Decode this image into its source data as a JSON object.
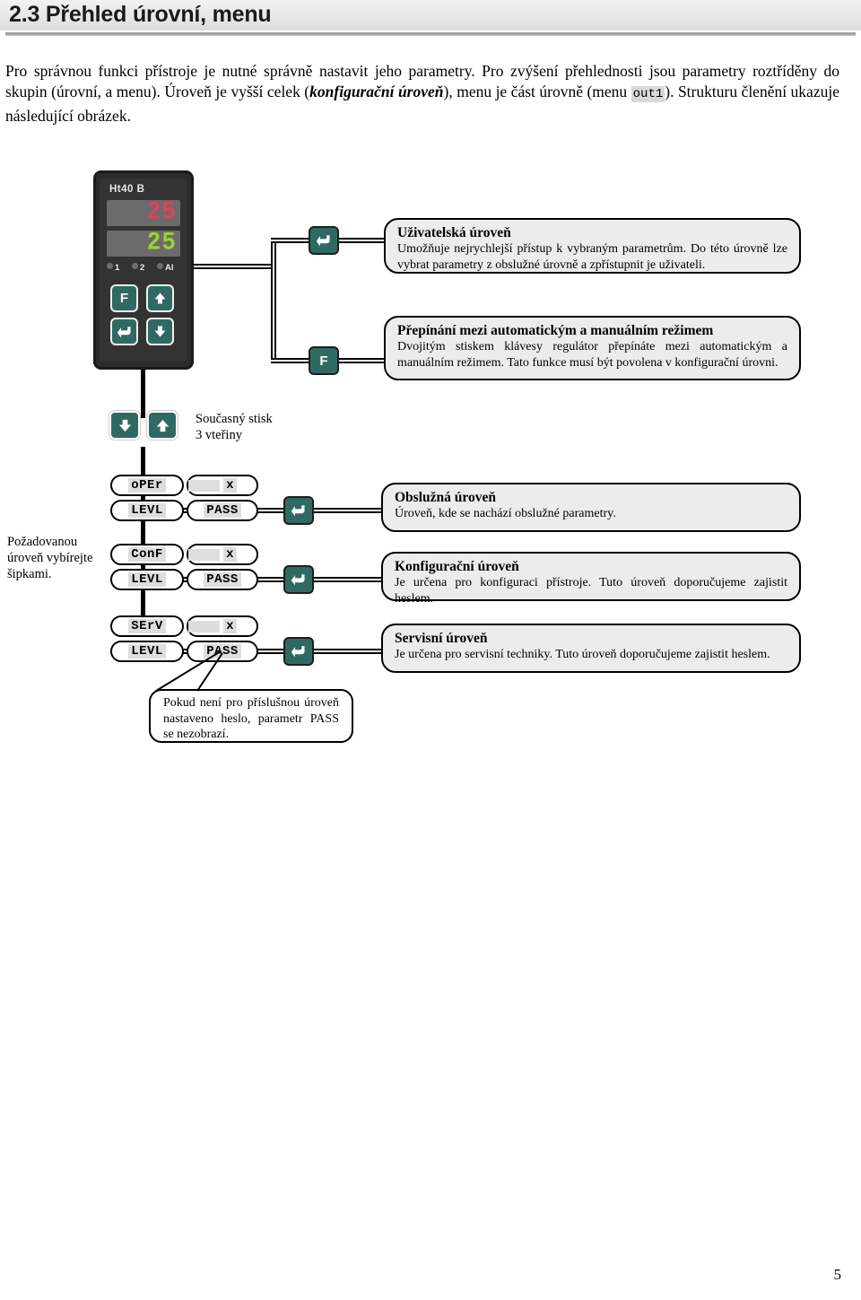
{
  "heading": {
    "number": "2.3",
    "title": "2.3 Přehled úrovní, menu"
  },
  "intro": {
    "part1": "Pro správnou funkci přístroje je nutné správně nastavit jeho parametry. Pro zvýšení přehlednosti jsou parametry roztříděny do skupin (úrovní, a menu). Úroveň je vyšší celek (",
    "emphasis": "konfigurační úroveň",
    "part2": "), menu je část úrovně (menu ",
    "code": "out1",
    "part3": "). Strukturu členění ukazuje následující obrázek."
  },
  "device": {
    "model": "Ht40 B",
    "display_top": "25",
    "display_bottom": "25",
    "display_top_color": "#e0405c",
    "display_bottom_color": "#9fd130",
    "leds": [
      "1",
      "2",
      "AI"
    ],
    "keys": {
      "function": "F",
      "enter": "↵",
      "up": "▲",
      "down": "▼"
    }
  },
  "callouts": [
    {
      "key": "↵",
      "title": "Uživatelská úroveň",
      "text": "Umožňuje nejrychlejší přístup k vybraným parametrům. Do této úrovně lze vybrat parametry z obslužné úrovně a zpřístupnit je uživateli."
    },
    {
      "key": "F",
      "title": "Přepínání mezi automatickým a manuálním režimem",
      "text": "Dvojitým stiskem klávesy regulátor přepínáte mezi automatickým a manuálním režimem. Tato funkce musí být povolena v konfigurační úrovni."
    }
  ],
  "simultaneous_press": {
    "line1": "Současný  stisk",
    "line2": "3 vteřiny",
    "key_down": "▼",
    "key_up": "▲"
  },
  "arrow_hint": "Požadovanou úroveň vybírejte šipkami.",
  "levels": [
    {
      "code_top": "oPEr",
      "code_bottom": "LEVL",
      "pass_top": "x",
      "pass_bottom": "PASS",
      "enter_key": "↵",
      "title": "Obslužná úroveň",
      "text": "Úroveň, kde se nachází obslužné parametry."
    },
    {
      "code_top": "ConF",
      "code_bottom": "LEVL",
      "pass_top": "x",
      "pass_bottom": "PASS",
      "enter_key": "↵",
      "title": "Konfigurační úroveň",
      "text": "Je určena pro konfiguraci přístroje.  Tuto úroveň doporučujeme zajistit heslem."
    },
    {
      "code_top": "SErV",
      "code_bottom": "LEVL",
      "pass_top": "x",
      "pass_bottom": "PASS",
      "enter_key": "↵",
      "title": "Servisní úroveň",
      "text": "Je určena pro servisní techniky.  Tuto úroveň doporučujeme zajistit heslem."
    }
  ],
  "note": "Pokud není pro příslušnou úroveň nastaveno heslo, parametr PASS  se nezobrazí.",
  "page_number": "5",
  "colors": {
    "key_teal": "#2f6a62",
    "box_fill": "#ececec",
    "heading_bar": "#e6e6e6"
  }
}
